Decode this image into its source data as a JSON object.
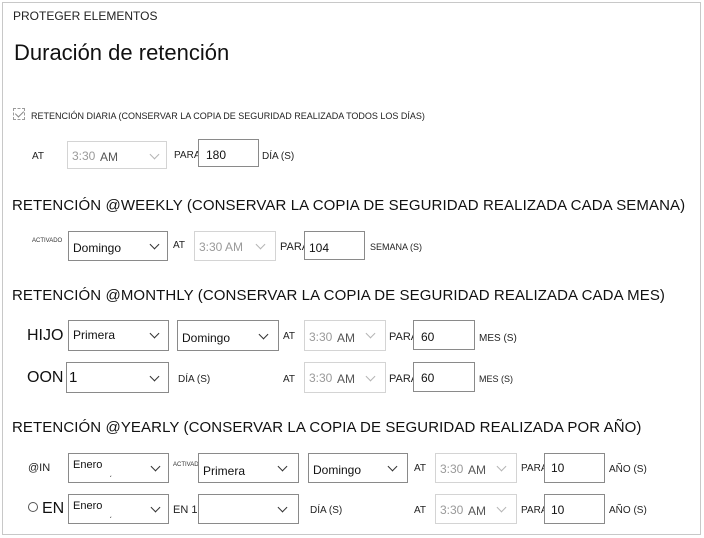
{
  "header": {
    "section_tag": "PROTEGER ELEMENTOS",
    "title": "Duración de retención"
  },
  "daily": {
    "checkbox_label": "RETENCIÓN DIARIA (CONSERVAR LA COPIA DE SEGURIDAD REALIZADA TODOS LOS DÍAS)",
    "checked": true,
    "at_label": "AT",
    "time": "3:30",
    "ampm": "AM",
    "para_label": "PARA",
    "days_value": "180",
    "unit_label": "DÍA (S)"
  },
  "weekly": {
    "heading": "RETENCIÓN @WEEKLY (CONSERVAR LA COPIA DE SEGURIDAD REALIZADA CADA SEMANA)",
    "on_label": "ACTIVADO",
    "day": "Domingo",
    "at_label": "AT",
    "time": "3:30 AM",
    "para_label": "PARA",
    "weeks_value": "104",
    "unit_label": "SEMANA (S)"
  },
  "monthly": {
    "heading": "RETENCIÓN @MONTHLY (CONSERVAR LA COPIA DE SEGURIDAD REALIZADA CADA MES)",
    "row1": {
      "prefix": "HIJO",
      "ordinal": "Primera",
      "day": "Domingo",
      "at_label": "AT",
      "time": "3:30",
      "ampm": "AM",
      "para_label": "PARA",
      "value": "60",
      "unit_label": "MES (S)"
    },
    "row2": {
      "prefix": "OON",
      "day_number": "1",
      "day_label": "DÍA (S)",
      "at_label": "AT",
      "time": "3:30",
      "ampm": "AM",
      "para_label": "PARA",
      "value": "60",
      "unit_label": "MES (S)"
    }
  },
  "yearly": {
    "heading": "RETENCIÓN @YEARLY (CONSERVAR LA COPIA DE SEGURIDAD REALIZADA POR AÑO)",
    "row1": {
      "prefix": "@IN",
      "month": "Enero",
      "on_label": "ACTIVADO",
      "ordinal": "Primera",
      "day": "Domingo",
      "at_label": "AT",
      "time": "3:30",
      "ampm": "AM",
      "para_label": "PARA",
      "value": "10",
      "unit_label": "AÑO (S)"
    },
    "row2": {
      "prefix": "EN",
      "month": "Enero",
      "en_label": "EN 1",
      "day_label": "DÍA (S)",
      "at_label": "AT",
      "time": "3:30",
      "ampm": "AM",
      "para_label": "PARA",
      "value": "10",
      "unit_label": "AÑO (S)"
    }
  }
}
